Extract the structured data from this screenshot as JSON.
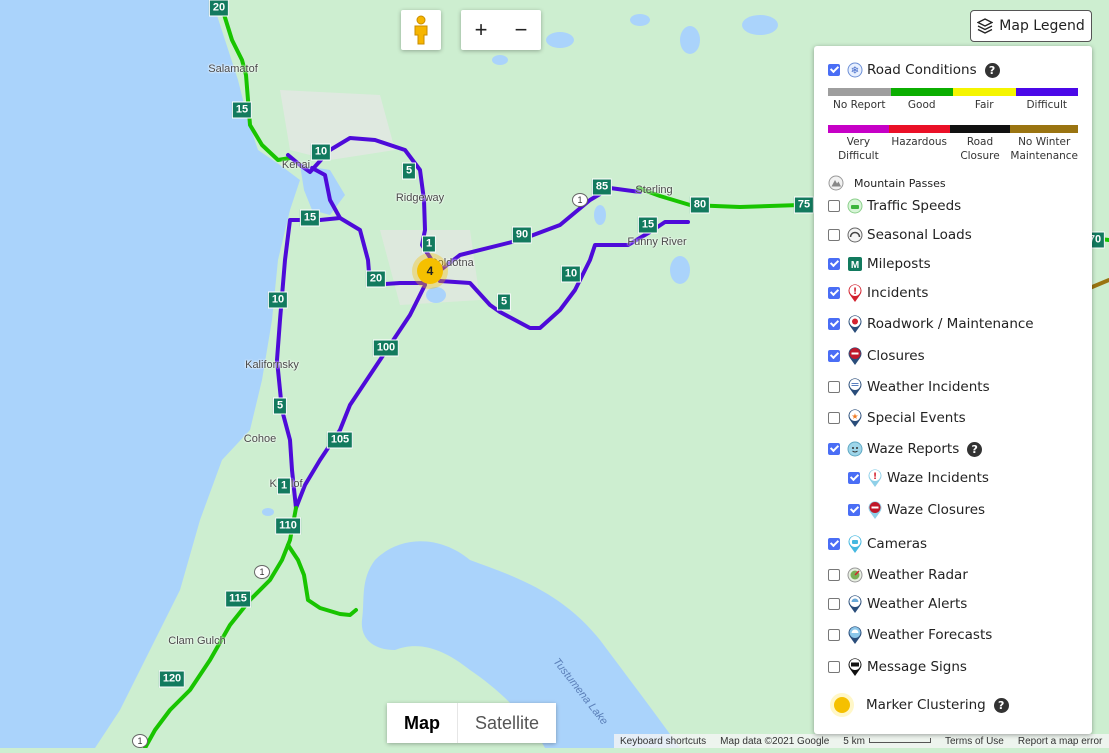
{
  "map": {
    "colors": {
      "water": "#aad3fb",
      "land": "#cdeed0",
      "urban": "#e8eae6",
      "good": "#18c400",
      "difficult": "#4e0bd9",
      "marker": "#127a5e"
    },
    "places": [
      "Salamatof",
      "Kenai",
      "Ridgeway",
      "Soldotna",
      "Sterling",
      "Funny River",
      "Kalifornsky",
      "Cohoe",
      "Kasilof",
      "Clam Gulch"
    ],
    "lake_label": "Tustumena Lake",
    "mileposts": [
      "20",
      "15",
      "10",
      "5",
      "15",
      "10",
      "1",
      "20",
      "90",
      "85",
      "80",
      "75",
      "15",
      "10",
      "5",
      "100",
      "5",
      "105",
      "1",
      "110",
      "115",
      "120",
      "70",
      "1"
    ],
    "route_shields": [
      "1",
      "1",
      "1"
    ],
    "cluster_count": "4"
  },
  "controls": {
    "zoom_in": "+",
    "zoom_out": "−",
    "map_type": {
      "map": "Map",
      "satellite": "Satellite",
      "selected": "Map"
    }
  },
  "attribution": {
    "shortcuts": "Keyboard shortcuts",
    "data": "Map data ©2021 Google",
    "scale": "5 km",
    "terms": "Terms of Use",
    "report": "Report a map error"
  },
  "legend": {
    "button_label": "Map Legend",
    "road_conditions": {
      "label": "Road Conditions",
      "checked": true,
      "conditions": [
        {
          "label": "No Report",
          "color": "#9e9e9e"
        },
        {
          "label": "Good",
          "color": "#0bae00"
        },
        {
          "label": "Fair",
          "color": "#f5f500"
        },
        {
          "label": "Difficult",
          "color": "#4b08e8"
        },
        {
          "label": "Very Difficult",
          "color": "#c600c6"
        },
        {
          "label": "Hazardous",
          "color": "#ea1027"
        },
        {
          "label": "Road Closure",
          "color": "#111111"
        },
        {
          "label": "No Winter Maintenance",
          "color": "#9a7411"
        }
      ]
    },
    "mountain_passes": "Mountain Passes",
    "layers": [
      {
        "label": "Traffic Speeds",
        "checked": false,
        "icon": "car-icon"
      },
      {
        "label": "Seasonal Loads",
        "checked": false,
        "icon": "gauge-icon"
      },
      {
        "label": "Mileposts",
        "checked": true,
        "icon": "milepost-icon"
      },
      {
        "label": "Incidents",
        "checked": true,
        "icon": "incident-pin-icon"
      },
      {
        "label": "Roadwork / Maintenance",
        "checked": true,
        "icon": "roadwork-pin-icon"
      },
      {
        "label": "Closures",
        "checked": true,
        "icon": "closure-pin-icon"
      },
      {
        "label": "Weather Incidents",
        "checked": false,
        "icon": "weather-incident-pin-icon"
      },
      {
        "label": "Special Events",
        "checked": false,
        "icon": "special-event-pin-icon"
      },
      {
        "label": "Waze Reports",
        "checked": true,
        "icon": "waze-icon"
      },
      {
        "label": "Waze Incidents",
        "checked": true,
        "icon": "waze-incident-pin-icon"
      },
      {
        "label": "Waze Closures",
        "checked": true,
        "icon": "waze-closure-pin-icon"
      },
      {
        "label": "Cameras",
        "checked": true,
        "icon": "camera-pin-icon"
      },
      {
        "label": "Weather Radar",
        "checked": false,
        "icon": "radar-icon"
      },
      {
        "label": "Weather Alerts",
        "checked": false,
        "icon": "weather-alert-pin-icon"
      },
      {
        "label": "Weather Forecasts",
        "checked": false,
        "icon": "forecast-pin-icon"
      },
      {
        "label": "Message Signs",
        "checked": false,
        "icon": "message-sign-pin-icon"
      }
    ],
    "marker_clustering": "Marker Clustering"
  }
}
